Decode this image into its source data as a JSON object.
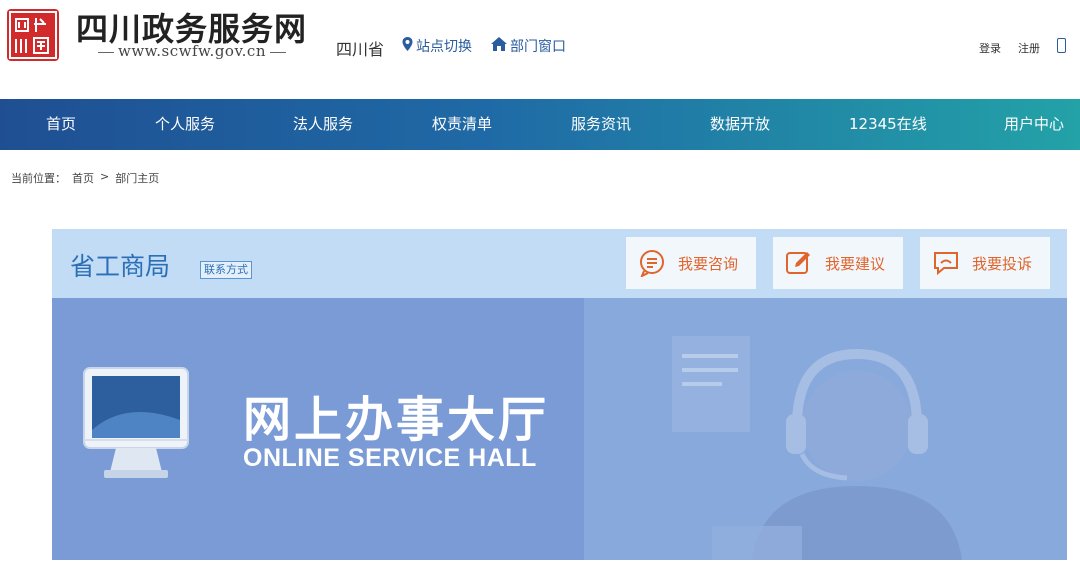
{
  "header": {
    "logo_icon": "seal-logo",
    "site_title": "四川政务服务网",
    "site_url": "www.scwfw.gov.cn",
    "region": "四川省",
    "switch_label": "站点切换",
    "dept_label": "部门窗口",
    "login": "登录",
    "register": "注册",
    "mobile_icon": "mobile-icon"
  },
  "nav": {
    "items": [
      "首页",
      "个人服务",
      "法人服务",
      "权责清单",
      "服务资讯",
      "数据开放",
      "12345在线",
      "用户中心"
    ]
  },
  "breadcrumb": {
    "prefix": "当前位置：",
    "items": [
      "首页",
      "部门主页"
    ],
    "separator": ">"
  },
  "department": {
    "name": "省工商局",
    "contact": "联系方式",
    "actions": [
      {
        "label": "我要咨询",
        "icon": "chat-icon"
      },
      {
        "label": "我要建议",
        "icon": "edit-icon"
      },
      {
        "label": "我要投诉",
        "icon": "complaint-icon"
      }
    ]
  },
  "banner": {
    "title": "网上办事大厅",
    "subtitle": "ONLINE SERVICE HALL"
  },
  "colors": {
    "nav_start": "#1f4f92",
    "nav_end": "#23a2a7",
    "accent_blue": "#2c6fb7",
    "action_orange": "#e0652d",
    "logo_red": "#d22a2a"
  }
}
